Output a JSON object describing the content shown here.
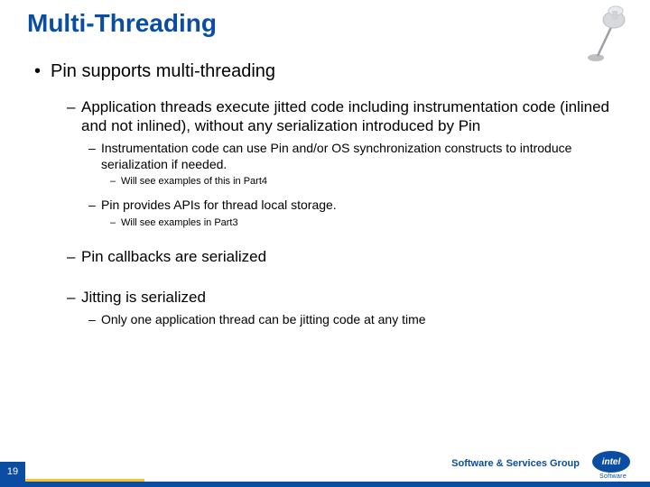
{
  "title": "Multi-Threading",
  "b1": "Pin supports multi-threading",
  "b1_1": "Application threads execute jitted code including instrumentation code (inlined and not inlined), without any serialization introduced by Pin",
  "b1_1_1": "Instrumentation code can use Pin and/or OS synchronization constructs to introduce serialization if needed.",
  "b1_1_1_1": "Will see examples of this in Part4",
  "b1_1_2": "Pin provides APIs for thread local storage.",
  "b1_1_2_1": "Will see examples in Part3",
  "b1_2": "Pin callbacks are serialized",
  "b1_3": "Jitting is serialized",
  "b1_3_1": "Only one application thread can be jitting code at any time",
  "footer_group": "Software & Services Group",
  "logo_text": "intel",
  "logo_sub": "Software",
  "page_number": "19"
}
